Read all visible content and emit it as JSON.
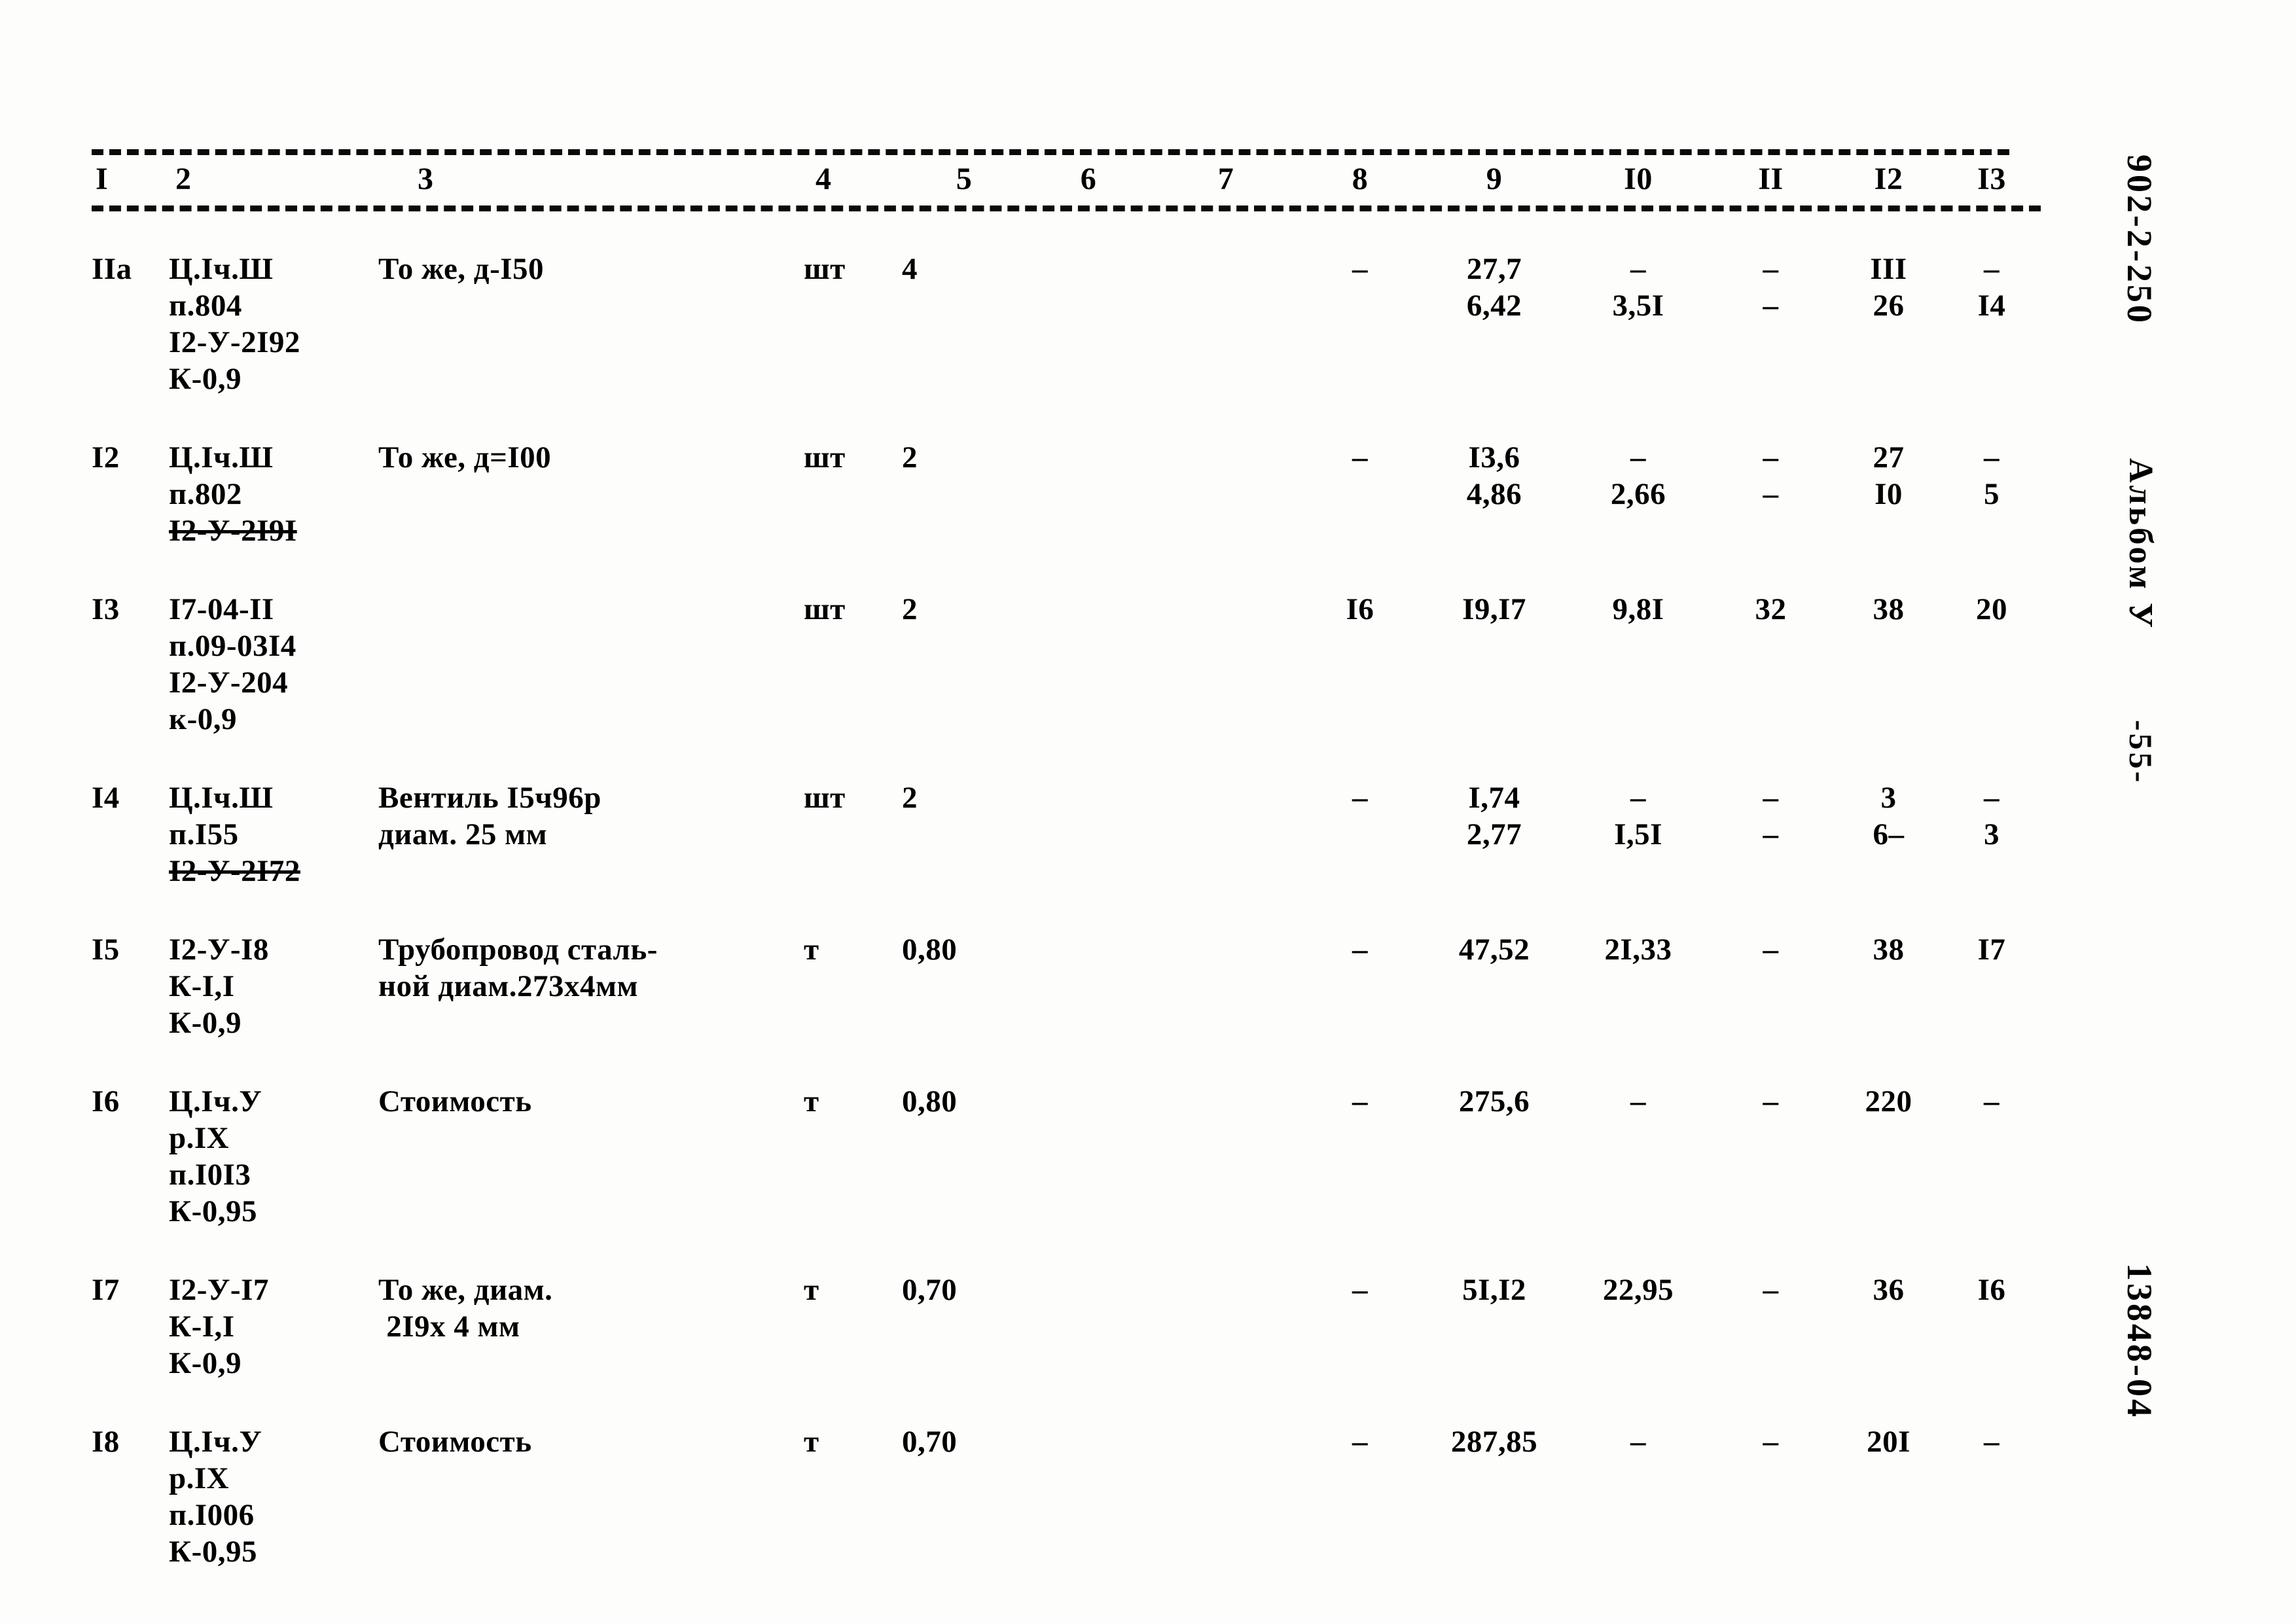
{
  "document": {
    "columns": [
      "I",
      "2",
      "3",
      "4",
      "5",
      "6",
      "7",
      "8",
      "9",
      "I0",
      "II",
      "I2",
      "I3"
    ],
    "rows": [
      {
        "num": "IIa",
        "code": [
          "Ц.Iч.Ш",
          "п.804",
          "I2-У-2I92",
          "К-0,9"
        ],
        "code_strike": [
          false,
          false,
          false,
          false
        ],
        "desc": [
          "То же, д-I50"
        ],
        "unit": "шт",
        "qty": "4",
        "c6": "",
        "c7": "",
        "c8": "–",
        "c9": [
          "27,7",
          "6,42"
        ],
        "c10": [
          "–",
          "3,5I"
        ],
        "c11": [
          "–",
          "–"
        ],
        "c12": [
          "III",
          "26"
        ],
        "c13": [
          "–",
          "I4"
        ]
      },
      {
        "num": "I2",
        "code": [
          "Ц.Iч.Ш",
          "п.802",
          "I2-У-2I9I"
        ],
        "code_strike": [
          false,
          false,
          true
        ],
        "desc": [
          "То же, д=I00"
        ],
        "unit": "шт",
        "qty": "2",
        "c6": "",
        "c7": "",
        "c8": "–",
        "c9": [
          "I3,6",
          "4,86"
        ],
        "c10": [
          "–",
          "2,66"
        ],
        "c11": [
          "–",
          "–"
        ],
        "c12": [
          "27",
          "I0"
        ],
        "c13": [
          "–",
          "5"
        ]
      },
      {
        "num": "I3",
        "code": [
          "I7-04-II",
          "п.09-03I4",
          "I2-У-204",
          "к-0,9"
        ],
        "code_strike": [
          false,
          false,
          false,
          false
        ],
        "desc": [
          ""
        ],
        "unit": "шт",
        "qty": "2",
        "c6": "",
        "c7": "",
        "c8": "I6",
        "c9": [
          "I9,I7"
        ],
        "c10": [
          "9,8I"
        ],
        "c11": [
          "32"
        ],
        "c12": [
          "38"
        ],
        "c13": [
          "20"
        ]
      },
      {
        "num": "I4",
        "code": [
          "Ц.Iч.Ш",
          "п.I55",
          "I2-У-2I72"
        ],
        "code_strike": [
          false,
          false,
          true
        ],
        "desc": [
          "Вентиль I5ч96р",
          "диам. 25 мм"
        ],
        "unit": "шт",
        "qty": "2",
        "c6": "",
        "c7": "",
        "c8": "–",
        "c9": [
          "I,74",
          "2,77"
        ],
        "c10": [
          "–",
          "I,5I"
        ],
        "c11": [
          "–",
          "–"
        ],
        "c12": [
          "3",
          "6–"
        ],
        "c13": [
          "–",
          "3"
        ]
      },
      {
        "num": "I5",
        "code": [
          "I2-У-I8",
          "К-I,I",
          "К-0,9"
        ],
        "code_strike": [
          false,
          false,
          false
        ],
        "desc": [
          "Трубопровод сталь-",
          "ной диам.273х4мм"
        ],
        "unit": "т",
        "qty": "0,80",
        "c6": "",
        "c7": "",
        "c8": "–",
        "c9": [
          "47,52"
        ],
        "c10": [
          "2I,33"
        ],
        "c11": [
          "–"
        ],
        "c12": [
          "38"
        ],
        "c13": [
          "I7"
        ]
      },
      {
        "num": "I6",
        "code": [
          "Ц.Iч.У",
          "р.IX",
          "п.I0I3",
          "К-0,95"
        ],
        "code_strike": [
          false,
          false,
          false,
          false
        ],
        "desc": [
          "Стоимость"
        ],
        "unit": "т",
        "qty": "0,80",
        "c6": "",
        "c7": "",
        "c8": "–",
        "c9": [
          "275,6"
        ],
        "c10": [
          "–"
        ],
        "c11": [
          "–"
        ],
        "c12": [
          "220"
        ],
        "c13": [
          "–"
        ]
      },
      {
        "num": "I7",
        "code": [
          "I2-У-I7",
          "К-I,I",
          "К-0,9"
        ],
        "code_strike": [
          false,
          false,
          false
        ],
        "desc": [
          "То же, диам.",
          " 2I9х 4 мм"
        ],
        "unit": "т",
        "qty": "0,70",
        "c6": "",
        "c7": "",
        "c8": "–",
        "c9": [
          "5I,I2"
        ],
        "c10": [
          "22,95"
        ],
        "c11": [
          "–"
        ],
        "c12": [
          "36"
        ],
        "c13": [
          "I6"
        ]
      },
      {
        "num": "I8",
        "code": [
          "Ц.Iч.У",
          "р.IX",
          "п.I006",
          "К-0,95"
        ],
        "code_strike": [
          false,
          false,
          false,
          false
        ],
        "desc": [
          "Стоимость"
        ],
        "unit": "т",
        "qty": "0,70",
        "c6": "",
        "c7": "",
        "c8": "–",
        "c9": [
          "287,85"
        ],
        "c10": [
          "–"
        ],
        "c11": [
          "–"
        ],
        "c12": [
          "20I"
        ],
        "c13": [
          "–"
        ]
      }
    ]
  },
  "margin": {
    "code": "902-2-250",
    "album": "Альбом У",
    "page": "-55-",
    "doc": "13848-04"
  }
}
